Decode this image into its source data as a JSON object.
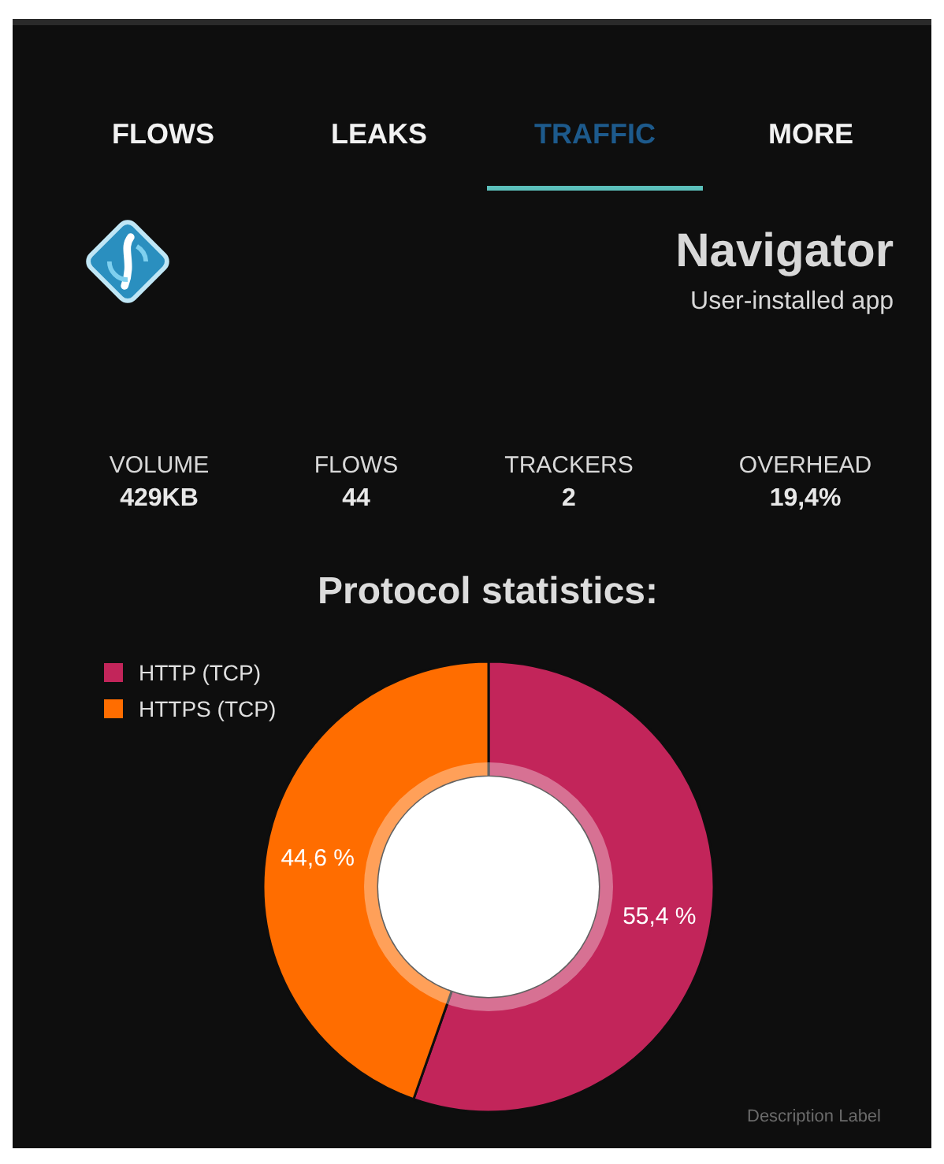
{
  "tabs": [
    {
      "label": "FLOWS",
      "selected": false
    },
    {
      "label": "LEAKS",
      "selected": false
    },
    {
      "label": "TRAFFIC",
      "selected": true
    },
    {
      "label": "MORE",
      "selected": false
    }
  ],
  "app": {
    "name": "Navigator",
    "subtitle": "User-installed app"
  },
  "stats": [
    {
      "label": "VOLUME",
      "value": "429KB"
    },
    {
      "label": "FLOWS",
      "value": "44"
    },
    {
      "label": "TRACKERS",
      "value": "2"
    },
    {
      "label": "OVERHEAD",
      "value": "19,4%"
    }
  ],
  "protocol_chart": {
    "title": "Protocol statistics:",
    "chart_data": {
      "type": "donut",
      "categories": [
        "HTTP (TCP)",
        "HTTPS (TCP)"
      ],
      "colors": [
        "#c2255a",
        "#ff6d00"
      ],
      "values": [
        55.4,
        44.6
      ],
      "value_labels": [
        "55,4 %",
        "44,6 %"
      ],
      "legend": "top-left"
    },
    "description": "Description Label"
  }
}
